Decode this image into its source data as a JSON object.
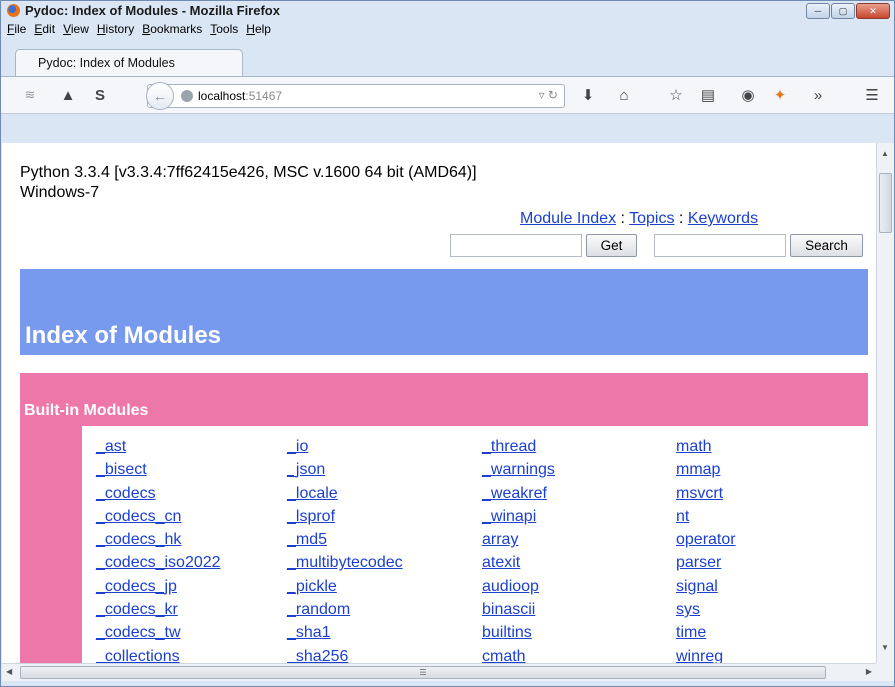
{
  "window": {
    "title": "Pydoc: Index of Modules - Mozilla Firefox",
    "controls": [
      "minimize",
      "maximize",
      "close"
    ]
  },
  "menu": [
    "File",
    "Edit",
    "View",
    "History",
    "Bookmarks",
    "Tools",
    "Help"
  ],
  "tab": {
    "label": "Pydoc: Index of Modules"
  },
  "toolbar": {
    "url_host": "localhost",
    "url_port": ":51467",
    "icons": [
      "rss-icon",
      "pocket-icon",
      "sync-icon",
      "download-icon",
      "home-icon",
      "star-icon",
      "reader-icon",
      "ghost-icon",
      "fox-icon",
      "overflow-icon",
      "hamburger-menu-icon"
    ]
  },
  "page": {
    "python_version": "Python 3.3.4 [v3.3.4:7ff62415e426, MSC v.1600 64 bit (AMD64)]",
    "os": "Windows-7",
    "nav": {
      "module_index": "Module Index",
      "sep1": " : ",
      "topics": "Topics",
      "sep2": " : ",
      "keywords": "Keywords"
    },
    "get_label": "Get",
    "search_label": "Search",
    "heading": "Index of Modules",
    "section_title": "Built-in Modules",
    "columns": [
      [
        "_ast",
        "_bisect",
        "_codecs",
        "_codecs_cn",
        "_codecs_hk",
        "_codecs_iso2022",
        "_codecs_jp",
        "_codecs_kr",
        "_codecs_tw",
        "_collections"
      ],
      [
        "_io",
        "_json",
        "_locale",
        "_lsprof",
        "_md5",
        "_multibytecodec",
        "_pickle",
        "_random",
        "_sha1",
        "_sha256"
      ],
      [
        "_thread",
        "_warnings",
        "_weakref",
        "_winapi",
        "array",
        "atexit",
        "audioop",
        "binascii",
        "builtins",
        "cmath"
      ],
      [
        "math",
        "mmap",
        "msvcrt",
        "nt",
        "operator",
        "parser",
        "signal",
        "sys",
        "time",
        "winreg"
      ]
    ]
  },
  "colors": {
    "heading_band": "#7799ee",
    "section_band": "#ee77aa",
    "link": "#1c3fce"
  }
}
